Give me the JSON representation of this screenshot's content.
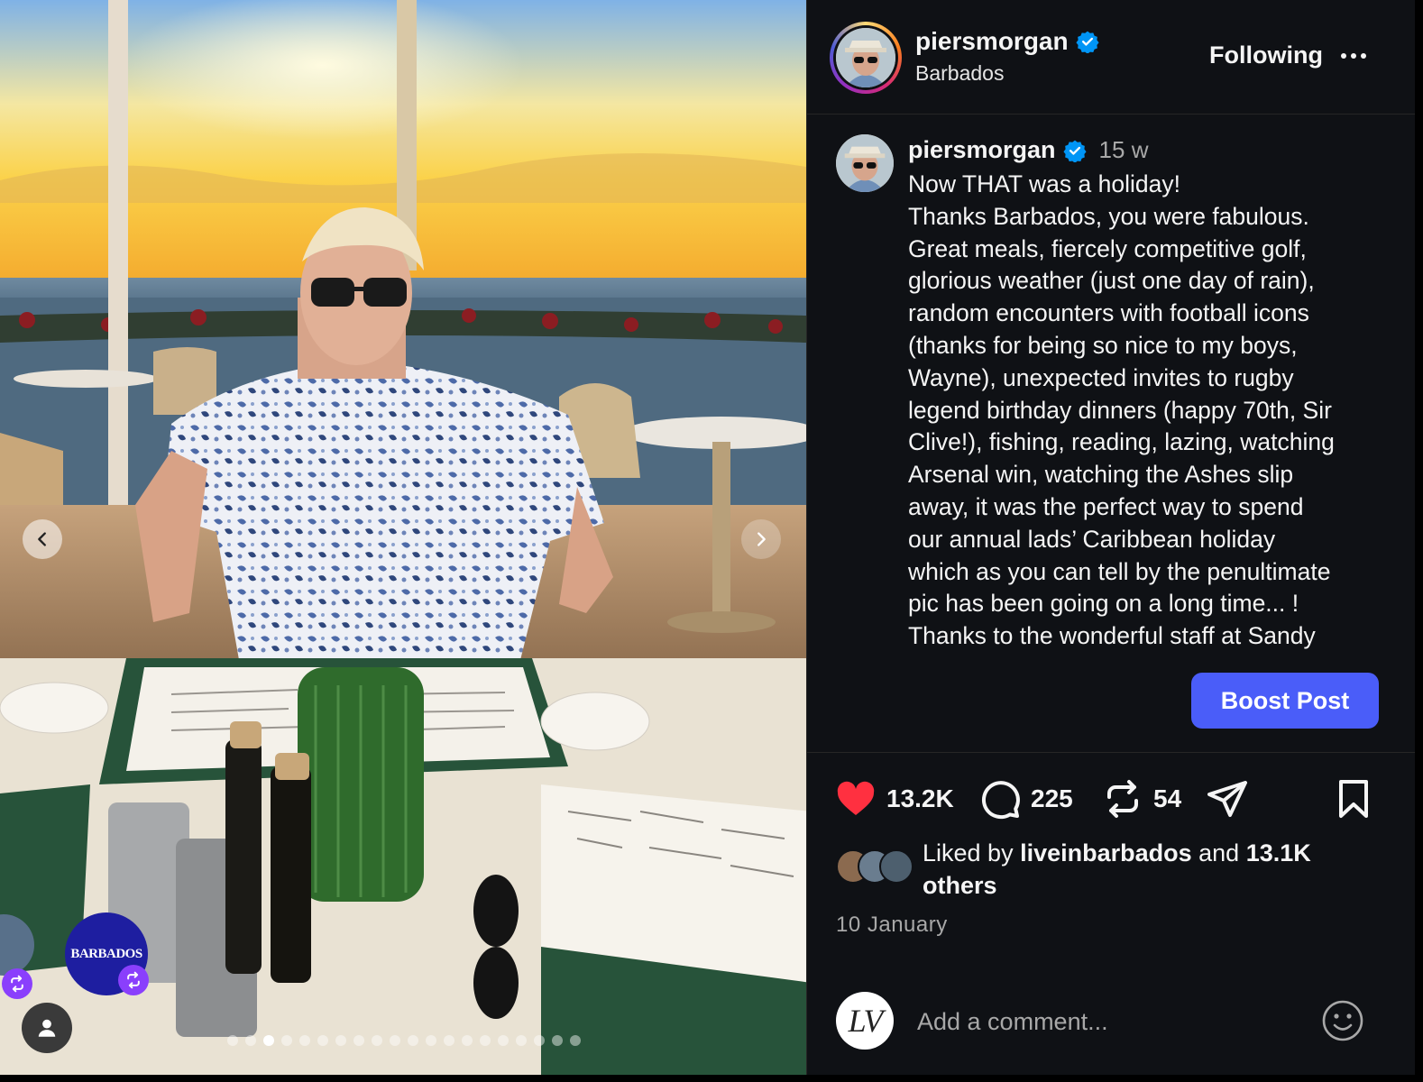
{
  "header": {
    "username": "piersmorgan",
    "location": "Barbados",
    "follow_label": "Following"
  },
  "post": {
    "username": "piersmorgan",
    "time_ago": "15 w",
    "caption": "Now THAT was a holiday!\nThanks Barbados, you were fabulous.\nGreat meals, fiercely competitive golf,\nglorious weather (just one day of rain),\nrandom encounters with football icons\n(thanks for being so nice to my boys,\nWayne), unexpected invites to rugby\nlegend birthday dinners (happy 70th, Sir\nClive!), fishing, reading, lazing, watching\nArsenal win, watching the Ashes slip\naway, it was the perfect way to spend\nour annual lads’ Caribbean holiday\nwhich as you can tell by the penultimate\npic has been going on a long time... !\nThanks to the wonderful staff at Sandy"
  },
  "boost_label": "Boost Post",
  "actions": {
    "likes": "13.2K",
    "comments": "225",
    "reposts": "54"
  },
  "liked_by": {
    "prefix": "Liked by ",
    "user": "liveinbarbados",
    "middle": " and ",
    "others": "13.1K others"
  },
  "date": "10 January",
  "comment": {
    "placeholder": "Add a comment...",
    "avatar_text": "LV"
  },
  "media": {
    "collab_badge_text": "BARBADOS",
    "carousel_count": 20,
    "carousel_active": 2
  },
  "colors": {
    "accent": "#4a5df9",
    "like": "#ff3040",
    "verified": "#0095f6"
  }
}
